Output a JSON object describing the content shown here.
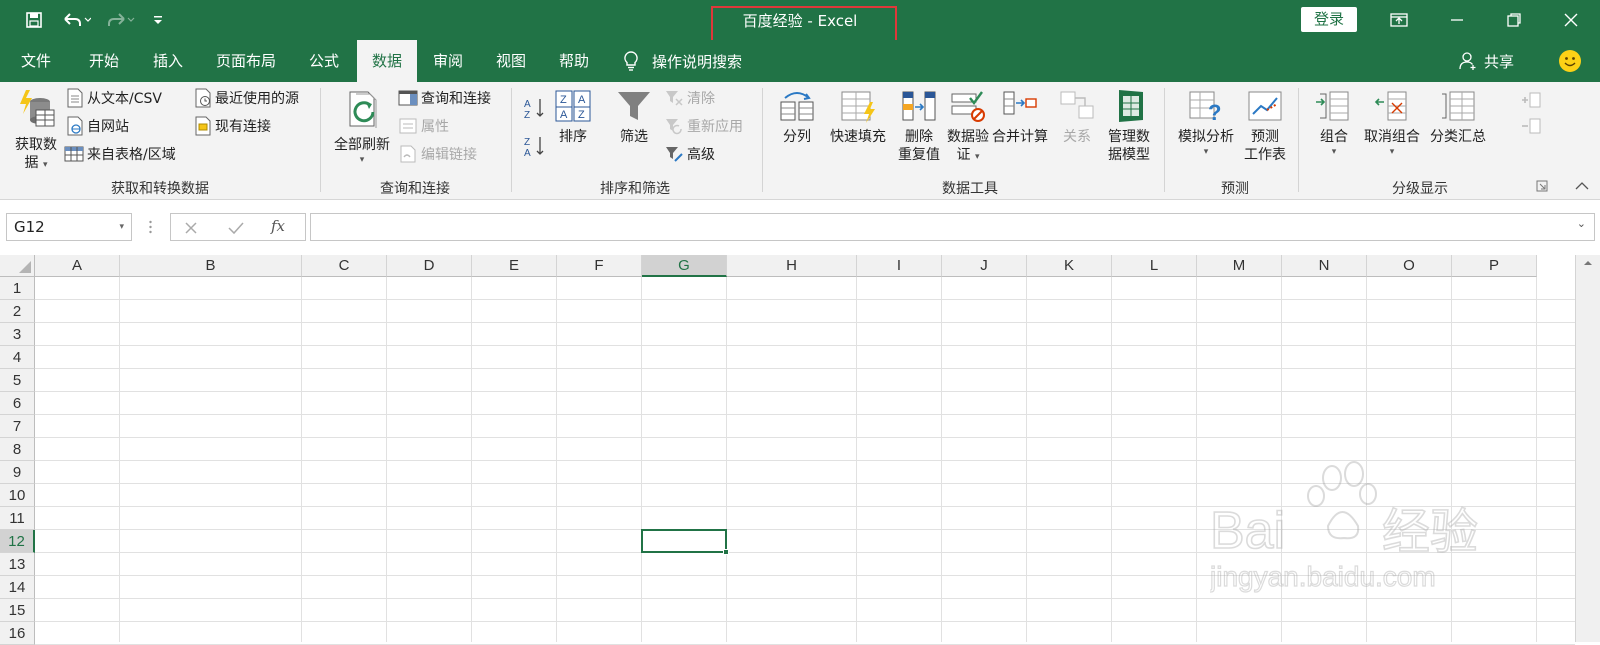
{
  "titlebar": {
    "title": "百度经验  -  Excel",
    "login_label": "登录",
    "bg": "#217346"
  },
  "tabs": [
    "文件",
    "开始",
    "插入",
    "页面布局",
    "公式",
    "数据",
    "审阅",
    "视图",
    "帮助"
  ],
  "active_tab": "数据",
  "tell_me": "操作说明搜索",
  "share_label": "共享",
  "ribbon": {
    "get_data": {
      "big_label_1": "获取数",
      "big_label_2": "据",
      "from_text": "从文本/CSV",
      "from_web": "自网站",
      "from_table": "来自表格/区域",
      "recent_sources": "最近使用的源",
      "existing_conn": "现有连接",
      "group": "获取和转换数据"
    },
    "queries": {
      "refresh_all": "全部刷新",
      "queries_conn": "查询和连接",
      "properties": "属性",
      "edit_links": "编辑链接",
      "group": "查询和连接"
    },
    "sort_filter": {
      "sort": "排序",
      "filter": "筛选",
      "clear": "清除",
      "reapply": "重新应用",
      "advanced": "高级",
      "group": "排序和筛选"
    },
    "data_tools": {
      "text_to_columns": "分列",
      "flash_fill": "快速填充",
      "remove_dup_1": "删除",
      "remove_dup_2": "重复值",
      "validation_1": "数据验",
      "validation_2": "证",
      "consolidate": "合并计算",
      "relationships": "关系",
      "data_model_1": "管理数",
      "data_model_2": "据模型",
      "group": "数据工具"
    },
    "forecast": {
      "what_if": "模拟分析",
      "forecast_1": "预测",
      "forecast_2": "工作表",
      "group": "预测"
    },
    "outline": {
      "group_btn": "组合",
      "ungroup": "取消组合",
      "subtotal": "分类汇总",
      "group": "分级显示"
    }
  },
  "formula_bar": {
    "name_box": "G12",
    "fx": "fx",
    "formula": ""
  },
  "columns": [
    "A",
    "B",
    "C",
    "D",
    "E",
    "F",
    "G",
    "H",
    "I",
    "J",
    "K",
    "L",
    "M",
    "N",
    "O",
    "P"
  ],
  "rows": [
    "1",
    "2",
    "3",
    "4",
    "5",
    "6",
    "7",
    "8",
    "9",
    "10",
    "11",
    "12",
    "13",
    "14",
    "15",
    "16"
  ],
  "selected_column": "G",
  "selected_row": "12",
  "watermark": {
    "brand": "Bai du 经验",
    "url": "jingyan.baidu.com"
  }
}
